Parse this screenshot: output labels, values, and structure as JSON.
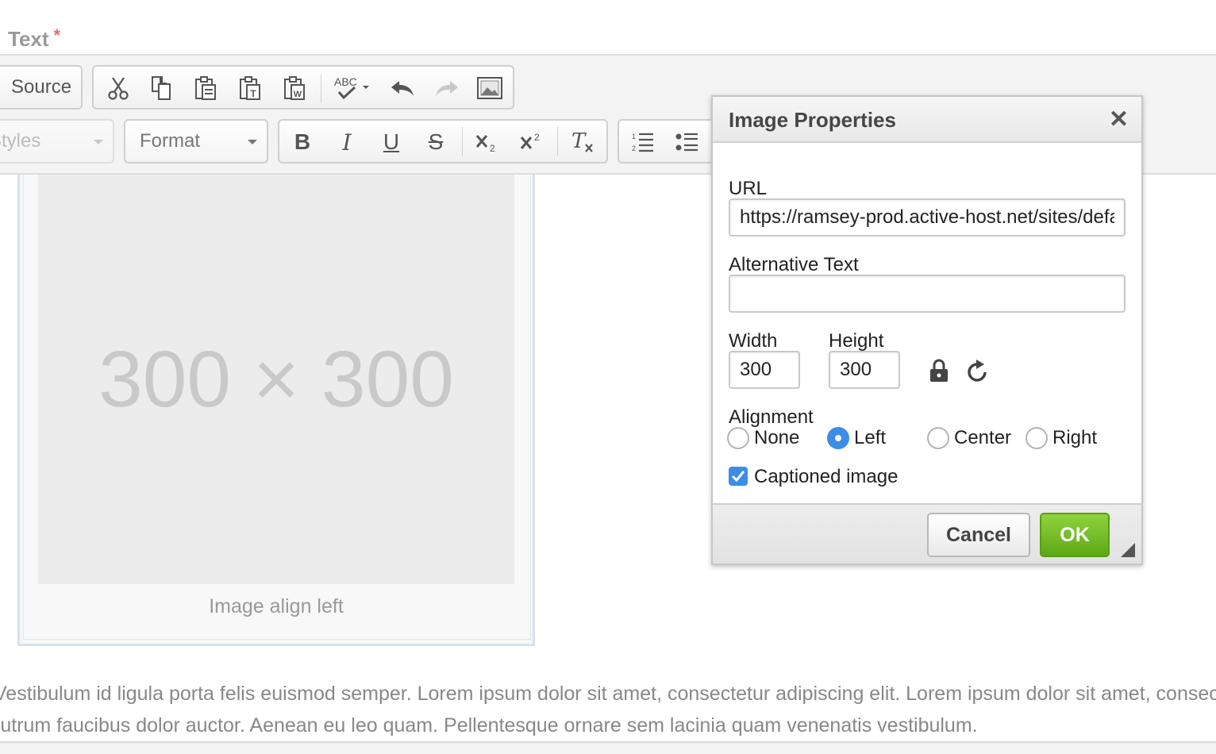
{
  "field": {
    "label": "Text",
    "required_mark": "*"
  },
  "toolbar": {
    "source_label": "Source",
    "styles_label": "Styles",
    "format_label": "Format",
    "bold_label": "B",
    "italic_label": "I",
    "underline_label": "U",
    "strike_label": "S",
    "icons": [
      "cut-icon",
      "copy-icon",
      "paste-icon",
      "paste-text-icon",
      "paste-word-icon",
      "spellcheck-icon",
      "undo-icon",
      "redo-icon",
      "image-icon",
      "subscript-icon",
      "superscript-icon",
      "remove-format-icon",
      "numbered-list-icon",
      "bulleted-list-icon"
    ]
  },
  "content": {
    "placeholder": "300 × 300",
    "caption": "Image align left",
    "paragraph_line1": "Vestibulum id ligula porta felis euismod semper. Lorem ipsum dolor sit amet, consectetur adipiscing elit. Lorem ipsum dolor sit amet, consectetur",
    "paragraph_line2": "rutrum faucibus dolor auctor. Aenean eu leo quam. Pellentesque ornare sem lacinia quam venenatis vestibulum."
  },
  "dialog": {
    "title": "Image Properties",
    "close": "✕",
    "url_label": "URL",
    "url_value": "https://ramsey-prod.active-host.net/sites/default/files/",
    "alt_label": "Alternative Text",
    "alt_value": "",
    "width_label": "Width",
    "width_value": "300",
    "height_label": "Height",
    "height_value": "300",
    "alignment_label": "Alignment",
    "alignment_options": [
      "None",
      "Left",
      "Center",
      "Right"
    ],
    "alignment_selected": "Left",
    "caption_label": "Captioned image",
    "caption_checked": true,
    "cancel_label": "Cancel",
    "ok_label": "OK"
  },
  "colors": {
    "accent": "#3b8de6",
    "ok_green": "#6cbc24",
    "required": "#e4706a"
  }
}
